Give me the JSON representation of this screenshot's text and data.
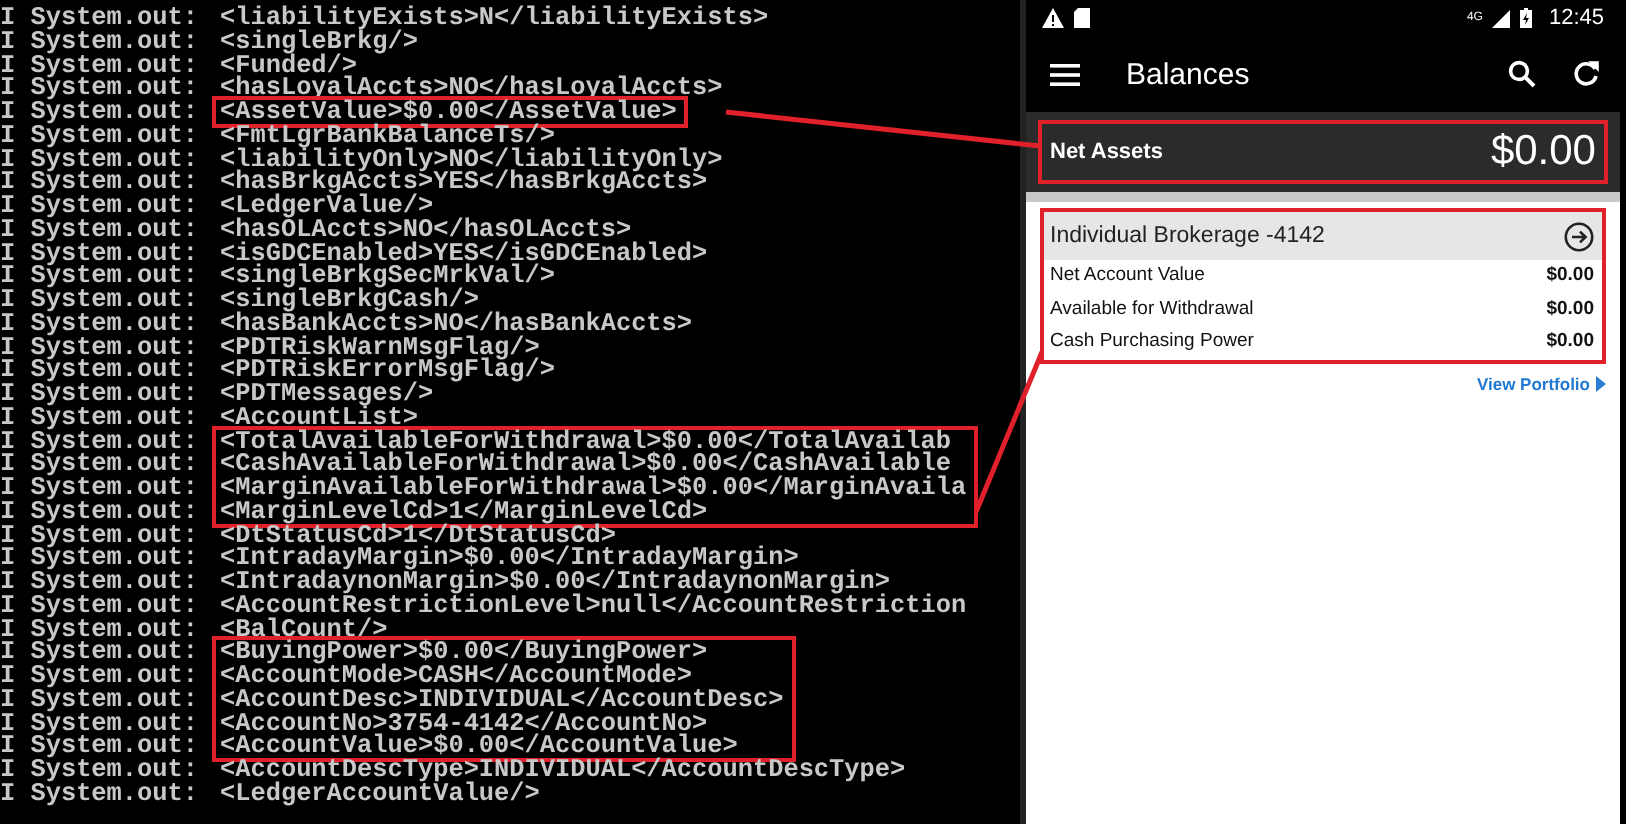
{
  "log": {
    "groups": [
      {
        "highlighted": false,
        "lines": [
          {
            "prefix": "I System.out:",
            "text": "<liabilityExists>N</liabilityExists>"
          },
          {
            "prefix": "I System.out:",
            "text": "<singleBrkg/>"
          },
          {
            "prefix": "I System.out:",
            "text": "<Funded/>"
          },
          {
            "prefix": "I System.out:",
            "text": "<hasLoyalAccts>NO</hasLoyalAccts>"
          }
        ]
      },
      {
        "highlighted": true,
        "lines": [
          {
            "prefix": "I System.out:",
            "text": "<AssetValue>$0.00</AssetValue>"
          }
        ]
      },
      {
        "highlighted": false,
        "lines": [
          {
            "prefix": "I System.out:",
            "text": "<FmtLgrBankBalanceTs/>"
          },
          {
            "prefix": "I System.out:",
            "text": "<liabilityOnly>NO</liabilityOnly>"
          },
          {
            "prefix": "I System.out:",
            "text": "<hasBrkgAccts>YES</hasBrkgAccts>"
          },
          {
            "prefix": "I System.out:",
            "text": "<LedgerValue/>"
          },
          {
            "prefix": "I System.out:",
            "text": "<hasOLAccts>NO</hasOLAccts>"
          },
          {
            "prefix": "I System.out:",
            "text": "<isGDCEnabled>YES</isGDCEnabled>"
          },
          {
            "prefix": "I System.out:",
            "text": "<singleBrkgSecMrkVal/>"
          },
          {
            "prefix": "I System.out:",
            "text": "<singleBrkgCash/>"
          },
          {
            "prefix": "I System.out:",
            "text": "<hasBankAccts>NO</hasBankAccts>"
          },
          {
            "prefix": "I System.out:",
            "text": "<PDTRiskWarnMsgFlag/>"
          },
          {
            "prefix": "I System.out:",
            "text": "<PDTRiskErrorMsgFlag/>"
          },
          {
            "prefix": "I System.out:",
            "text": "<PDTMessages/>"
          },
          {
            "prefix": "I System.out:",
            "text": "<AccountList>"
          }
        ]
      },
      {
        "highlighted": true,
        "lines": [
          {
            "prefix": "I System.out:",
            "text": "<TotalAvailableForWithdrawal>$0.00</TotalAvailab"
          },
          {
            "prefix": "I System.out:",
            "text": "<CashAvailableForWithdrawal>$0.00</CashAvailable"
          },
          {
            "prefix": "I System.out:",
            "text": "<MarginAvailableForWithdrawal>$0.00</MarginAvaila"
          },
          {
            "prefix": "I System.out:",
            "text": "<MarginLevelCd>1</MarginLevelCd>"
          }
        ]
      },
      {
        "highlighted": false,
        "lines": [
          {
            "prefix": "I System.out:",
            "text": "<DtStatusCd>1</DtStatusCd>"
          },
          {
            "prefix": "I System.out:",
            "text": "<IntradayMargin>$0.00</IntradayMargin>"
          },
          {
            "prefix": "I System.out:",
            "text": "<IntradaynonMargin>$0.00</IntradaynonMargin>"
          },
          {
            "prefix": "I System.out:",
            "text": "<AccountRestrictionLevel>null</AccountRestriction"
          },
          {
            "prefix": "I System.out:",
            "text": "<BalCount/>"
          }
        ]
      },
      {
        "highlighted": true,
        "lines": [
          {
            "prefix": "I System.out:",
            "text": "<BuyingPower>$0.00</BuyingPower>"
          },
          {
            "prefix": "I System.out:",
            "text": "<AccountMode>CASH</AccountMode>"
          },
          {
            "prefix": "I System.out:",
            "text": "<AccountDesc>INDIVIDUAL</AccountDesc>"
          },
          {
            "prefix": "I System.out:",
            "text": "<AccountNo>3754-4142</AccountNo>"
          },
          {
            "prefix": "I System.out:",
            "text": "<AccountValue>$0.00</AccountValue>"
          }
        ]
      },
      {
        "highlighted": false,
        "lines": [
          {
            "prefix": "I System.out:",
            "text": "<AccountDescType>INDIVIDUAL</AccountDescType>"
          },
          {
            "prefix": "I System.out:",
            "text": "<LedgerAccountValue/>"
          }
        ]
      }
    ]
  },
  "status_bar": {
    "network": "4G",
    "time": "12:45"
  },
  "app_bar": {
    "title": "Balances"
  },
  "net_assets": {
    "label": "Net Assets",
    "value": "$0.00",
    "highlighted": true
  },
  "account": {
    "title": "Individual Brokerage -4142",
    "highlighted": true,
    "rows": [
      {
        "label": "Net Account Value",
        "value": "$0.00"
      },
      {
        "label": "Available for Withdrawal",
        "value": "$0.00"
      },
      {
        "label": "Cash Purchasing Power",
        "value": "$0.00"
      }
    ]
  },
  "link": {
    "label": "View Portfolio"
  }
}
